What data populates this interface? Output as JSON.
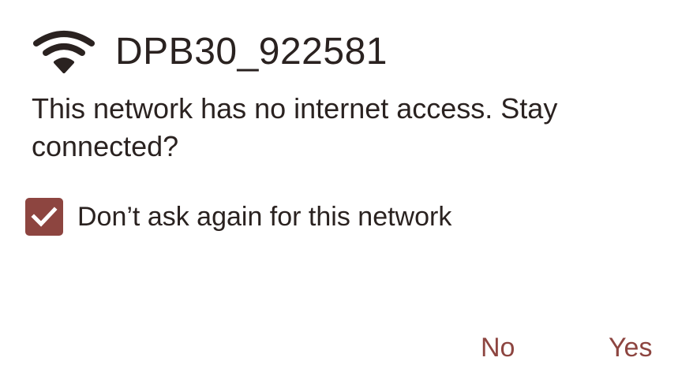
{
  "dialog": {
    "title": "DPB30_922581",
    "title_icon": "wifi-icon",
    "message": "This network has no internet access. Stay connected?",
    "checkbox": {
      "label": "Don’t ask again for this network",
      "checked": true
    },
    "buttons": {
      "no": "No",
      "yes": "Yes"
    }
  },
  "colors": {
    "accent": "#8d4540",
    "text": "#2a2220",
    "background": "#ffffff"
  }
}
